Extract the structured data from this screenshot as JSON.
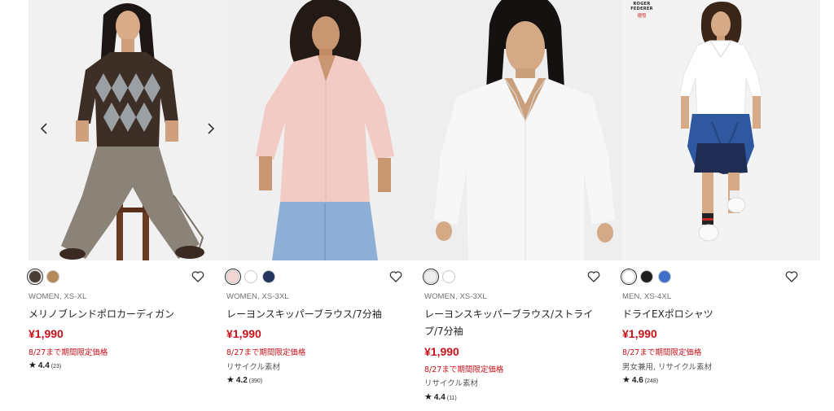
{
  "products": [
    {
      "brand_tag": null,
      "meta": "WOMEN, XS-XL",
      "name": "メリノブレンドポロカーディガン",
      "price": "¥1,990",
      "promo": "8/27まで期間限定価格",
      "material": "",
      "rating": "4.4",
      "review_count": "(23)",
      "swatches": [
        {
          "color": "#4a3f36",
          "selected": true
        },
        {
          "color": "#b58a5a",
          "selected": false
        }
      ],
      "has_carousel_arrows": true
    },
    {
      "brand_tag": null,
      "meta": "WOMEN, XS-3XL",
      "name": "レーヨンスキッパーブラウス/7分袖",
      "price": "¥1,990",
      "promo": "8/27まで期間限定価格",
      "material": "リサイクル素材",
      "rating": "4.2",
      "review_count": "(390)",
      "swatches": [
        {
          "color": "#f2d4d0",
          "selected": true
        },
        {
          "color": "#ffffff",
          "selected": false
        },
        {
          "color": "#243660",
          "selected": false
        }
      ],
      "has_carousel_arrows": false
    },
    {
      "brand_tag": null,
      "meta": "WOMEN, XS-3XL",
      "name": "レーヨンスキッパーブラウス/ストライプ/7分袖",
      "price": "¥1,990",
      "promo": "8/27まで期間限定価格",
      "material": "リサイクル素材",
      "rating": "4.4",
      "review_count": "(11)",
      "swatches": [
        {
          "color": "#eeeeee",
          "selected": true
        },
        {
          "color": "#ffffff",
          "selected": false
        }
      ],
      "has_carousel_arrows": false
    },
    {
      "brand_tag": {
        "line1": "ROGER FEDERER",
        "line2": "德發"
      },
      "meta": "MEN, XS-4XL",
      "name": "ドライEXポロシャツ",
      "price": "¥1,990",
      "promo": "8/27まで期間限定価格",
      "material": "男女兼用, リサイクル素材",
      "rating": "4.6",
      "review_count": "(248)",
      "swatches": [
        {
          "color": "#ffffff",
          "selected": true
        },
        {
          "color": "#1f1f1f",
          "selected": false
        },
        {
          "color": "#3f6fc9",
          "selected": false
        }
      ],
      "has_carousel_arrows": false
    }
  ],
  "icons": {
    "favorite": "heart-outline-icon",
    "star": "star-icon",
    "prev": "chevron-left-icon",
    "next": "chevron-right-icon"
  },
  "colors": {
    "price_red": "#c6121a",
    "text": "#222222",
    "meta_gray": "#6f6f6f"
  }
}
